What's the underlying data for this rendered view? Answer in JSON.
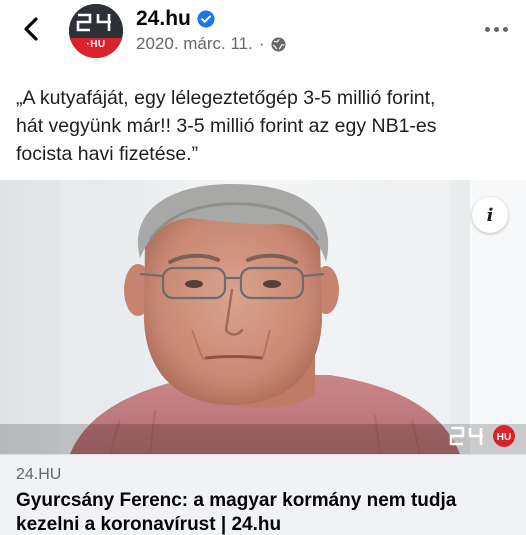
{
  "header": {
    "page_name": "24.hu",
    "date": "2020. márc. 11.",
    "separator": "·",
    "avatar_text_top": "24",
    "avatar_text_bottom": "·HU",
    "verified": true,
    "icons": {
      "back": "chevron-left-icon",
      "verified": "verified-badge-icon",
      "privacy": "globe-icon",
      "more": "more-options-icon"
    }
  },
  "post": {
    "text_lines": [
      "„A kutyafáját, egy lélegeztetőgép 3-5 millió forint,",
      "hát vegyünk már!! 3-5 millió forint az egy NB1-es",
      "focista havi fizetése.”"
    ]
  },
  "media": {
    "info_label": "i",
    "watermark_text": "24",
    "watermark_badge": "HU"
  },
  "link_preview": {
    "domain": "24.HU",
    "title": "Gyurcsány Ferenc: a magyar kormány nem tudja kezelni a koronavírust | 24.hu"
  },
  "colors": {
    "verified_blue": "#1877f2",
    "brand_red": "#d8232a",
    "secondary_text": "#65676b",
    "link_box_bg": "#f0f2f5"
  }
}
